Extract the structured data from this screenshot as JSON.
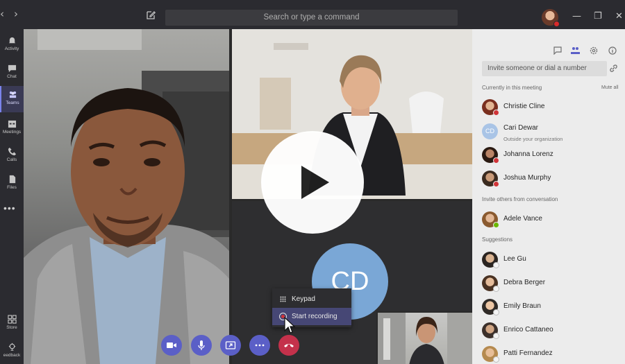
{
  "titlebar": {
    "back": "‹",
    "forward": "›",
    "search_placeholder": "Search or type a command",
    "minimize": "—",
    "restore": "❐",
    "close": "✕"
  },
  "rail": {
    "items": [
      {
        "label": "Activity",
        "icon": "bell-icon"
      },
      {
        "label": "Chat",
        "icon": "chat-icon"
      },
      {
        "label": "Teams",
        "icon": "teams-icon",
        "active": true
      },
      {
        "label": "Meetings",
        "icon": "calendar-icon"
      },
      {
        "label": "Calls",
        "icon": "phone-icon"
      },
      {
        "label": "Files",
        "icon": "file-icon"
      },
      {
        "label": "Store",
        "icon": "store-icon"
      },
      {
        "label": "eedback",
        "icon": "feedback-icon"
      }
    ],
    "more": "•••"
  },
  "call": {
    "avatar_initials": "CD",
    "menu": {
      "keypad": "Keypad",
      "start_recording": "Start recording"
    },
    "controls": [
      "video-icon",
      "mic-icon",
      "share-screen-icon",
      "more-icon",
      "hang-up-icon"
    ]
  },
  "panel": {
    "invite_placeholder": "Invite someone or dial a number",
    "currently_in_meeting": "Currently in this meeting",
    "mute_all": "Mute all",
    "participants": [
      {
        "name": "Christie Cline",
        "status": "busy"
      },
      {
        "name": "Cari Dewar",
        "initials": "CD",
        "sub": "Outside your organization"
      },
      {
        "name": "Johanna Lorenz",
        "status": "busy"
      },
      {
        "name": "Joshua Murphy",
        "status": "busy"
      }
    ],
    "invite_others": "Invite others from conversation",
    "others": [
      {
        "name": "Adele Vance",
        "status": "available"
      }
    ],
    "suggestions_label": "Suggestions",
    "suggestions": [
      {
        "name": "Lee Gu"
      },
      {
        "name": "Debra Berger"
      },
      {
        "name": "Emily Braun"
      },
      {
        "name": "Enrico Cattaneo"
      },
      {
        "name": "Patti Fernandez"
      }
    ]
  },
  "colors": {
    "accent": "#5b5fc7",
    "hangup": "#c4314b",
    "busy": "#d13438",
    "available": "#6bb700",
    "panel_bg": "#ececec",
    "chrome_bg": "#2b2b30"
  }
}
